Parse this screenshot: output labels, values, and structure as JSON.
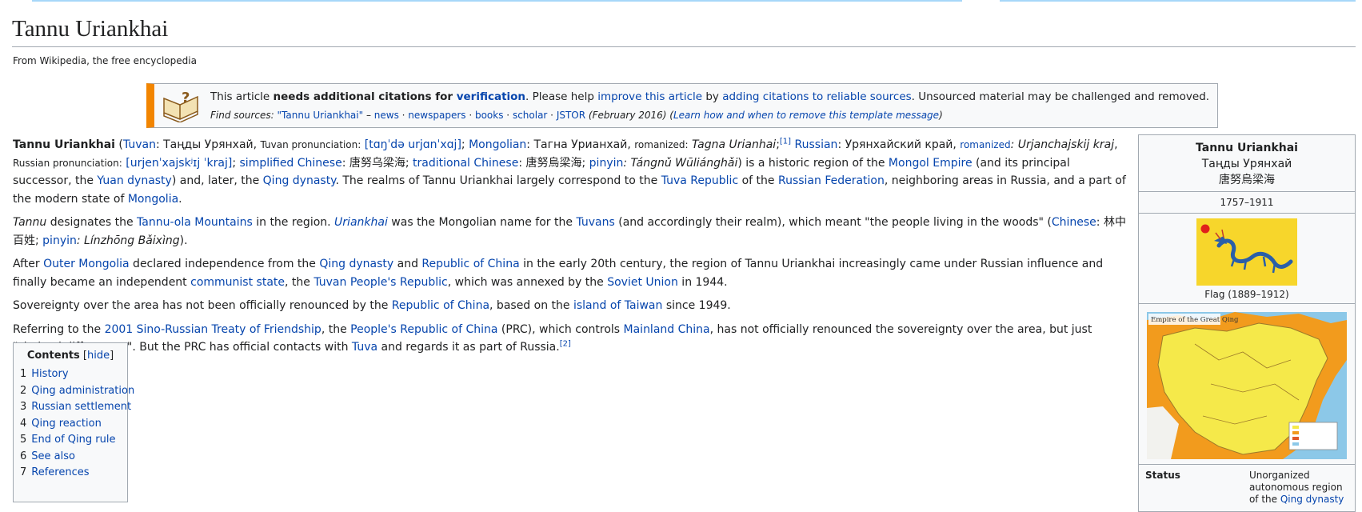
{
  "page": {
    "title": "Tannu Uriankhai",
    "tagline": "From Wikipedia, the free encyclopedia"
  },
  "ambox": {
    "icon": "book-question-icon",
    "t1": "This article ",
    "t2": "needs additional citations for ",
    "t3": "verification",
    "t4": ". Please help ",
    "t5": "improve this article",
    "t6": " by ",
    "t7": "adding citations to reliable sources",
    "t8": ". Unsourced material may be challenged and removed.",
    "f1": "Find sources:",
    "f2": "\"Tannu Uriankhai\"",
    "f3": " – ",
    "f4": "news",
    "f5": " · ",
    "f6": "newspapers",
    "f7": "books",
    "f8": "scholar",
    "f9": "JSTOR",
    "f10": " (February 2016) (",
    "f11": "Learn how and when to remove this template message",
    "f12": ")"
  },
  "p1": {
    "a": "Tannu Uriankhai",
    "b": " (",
    "c": "Tuvan",
    "d": ": Таңды Урянхай, ",
    "e": "Tuvan pronunciation:",
    "f": " [tɑŋˈdə urjɑnˈxɑj]",
    "g": "; ",
    "h": "Mongolian",
    "i": ": Тагна Урианхай, ",
    "j": "romanized:",
    "k": " Tagna Urianhai",
    "l": ";",
    "m": "[1]",
    "n": " ",
    "o": "Russian",
    "p": ": Урянхайский край, ",
    "q": "romanized",
    "r": ": Urjanchajskij kraj",
    "s": ", ",
    "t": "Russian pronunciation:",
    "u": " [urjenˈxajskʲɪj ˈkraj]",
    "v": "; ",
    "w": "simplified Chinese",
    "x": ": 唐努乌梁海; ",
    "y": "traditional Chinese",
    "z": ": 唐努烏梁海; ",
    "aa": "pinyin",
    "ab": ": Tángnǔ Wūliánghǎi",
    "ac": ") is a historic region of the ",
    "ad": "Mongol Empire",
    "ae": " (and its principal successor, the ",
    "af": "Yuan dynasty",
    "ag": ") and, later, the ",
    "ah": "Qing dynasty",
    "ai": ". The realms of Tannu Uriankhai largely correspond to the ",
    "aj": "Tuva Republic",
    "ak": " of the ",
    "al": "Russian Federation",
    "am": ", neighboring areas in Russia, and a part of the modern state of ",
    "an": "Mongolia",
    "ao": "."
  },
  "p2": {
    "a": "Tannu",
    "b": " designates the ",
    "c": "Tannu-ola Mountains",
    "d": " in the region. ",
    "e": "Uriankhai",
    "f": " was the Mongolian name for the ",
    "g": "Tuvans",
    "h": " (and accordingly their realm), which meant \"the people living in the woods\" (",
    "i": "Chinese",
    "j": ": 林中百姓; ",
    "k": "pinyin",
    "l": ": Línzhōng Bǎixìng",
    "m": ")."
  },
  "p3": {
    "a": "After ",
    "b": "Outer Mongolia",
    "c": " declared independence from the ",
    "d": "Qing dynasty",
    "e": " and ",
    "f": "Republic of China",
    "g": " in the early 20th century, the region of Tannu Uriankhai increasingly came under Russian influence and finally became an independent ",
    "h": "communist state",
    "i": ", the ",
    "j": "Tuvan People's Republic",
    "k": ", which was annexed by the ",
    "l": "Soviet Union",
    "m": " in 1944."
  },
  "p4": {
    "a": "Sovereignty over the area has not been officially renounced by the ",
    "b": "Republic of China",
    "c": ", based on the ",
    "d": "island of Taiwan",
    "e": " since 1949."
  },
  "p5": {
    "a": "Referring to the ",
    "b": "2001 Sino-Russian Treaty of Friendship",
    "c": ", the ",
    "d": "People's Republic of China",
    "e": " (PRC), which controls ",
    "f": "Mainland China",
    "g": ", has not officially renounced the sovereignty over the area, but just \"shelved differences\". But the PRC has official contacts with ",
    "h": "Tuva",
    "i": " and regards it as part of Russia.",
    "j": "[2]"
  },
  "toc": {
    "title": "Contents",
    "hide_open": " [",
    "hide": "hide",
    "hide_close": "]",
    "items": [
      {
        "num": "1",
        "label": "History"
      },
      {
        "num": "2",
        "label": "Qing administration"
      },
      {
        "num": "3",
        "label": "Russian settlement"
      },
      {
        "num": "4",
        "label": "Qing reaction"
      },
      {
        "num": "5",
        "label": "End of Qing rule"
      },
      {
        "num": "6",
        "label": "See also"
      },
      {
        "num": "7",
        "label": "References"
      }
    ]
  },
  "infobox": {
    "name": "Tannu Uriankhai",
    "name_tuvan": "Таңды Урянхай",
    "name_chinese": "唐努烏梁海",
    "years": "1757–1911",
    "flag_caption": "Flag (1889–1912)",
    "map_title": "Empire of the Great Qing",
    "status_label": "Status",
    "status_value": "Unorganized autonomous region of the ",
    "status_link": "Qing dynasty",
    "colors": {
      "flag_yellow": "#f7d62b",
      "flag_sun": "#e0201b",
      "dragon": "#2a5fa8",
      "map_sea": "#8cc8e8",
      "map_land": "#f5e94a",
      "map_orange": "#f29b1d"
    }
  }
}
